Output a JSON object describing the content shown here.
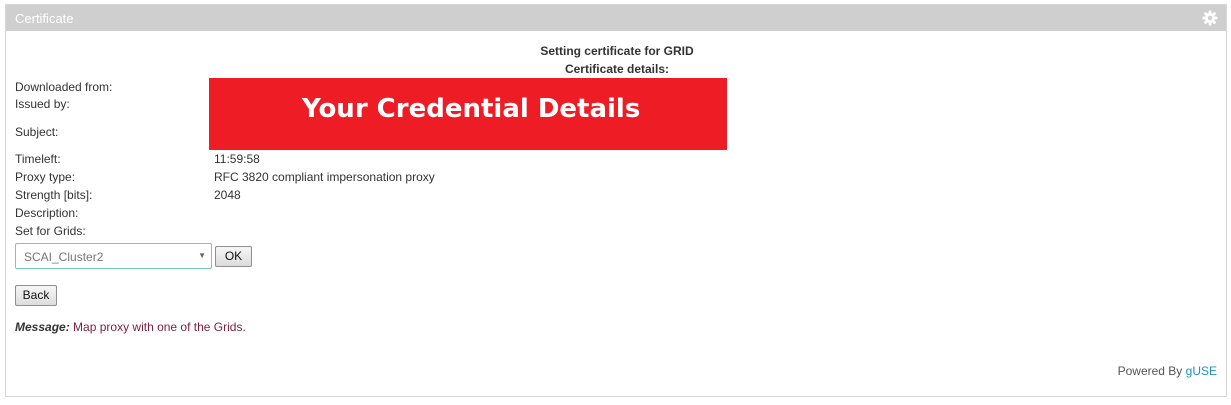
{
  "portlet": {
    "title": "Certificate"
  },
  "heading": {
    "line1": "Setting certificate for GRID",
    "line2": "Certificate details:"
  },
  "fields": {
    "downloaded_from": {
      "label": "Downloaded from:"
    },
    "issued_by": {
      "label": "Issued by:"
    },
    "subject": {
      "label": "Subject:"
    },
    "timeleft": {
      "label": "Timeleft:",
      "value": "11:59:58"
    },
    "proxy_type": {
      "label": "Proxy type:",
      "value": "RFC 3820 compliant impersonation proxy"
    },
    "strength": {
      "label": "Strength [bits]:",
      "value": "2048"
    },
    "description": {
      "label": "Description:"
    },
    "set_for_grids": {
      "label": "Set for Grids:"
    }
  },
  "redaction": {
    "text": "Your Credential Details",
    "color": "#ee1c25"
  },
  "grid_select": {
    "selected": "SCAI_Cluster2"
  },
  "buttons": {
    "ok": "OK",
    "back": "Back"
  },
  "message": {
    "label": "Message:",
    "text": "Map proxy with one of the Grids."
  },
  "footer": {
    "powered_by": "Powered By",
    "link": "gUSE"
  },
  "icons": {
    "settings": "gear-icon",
    "dropdown": "chevron-down-icon"
  }
}
